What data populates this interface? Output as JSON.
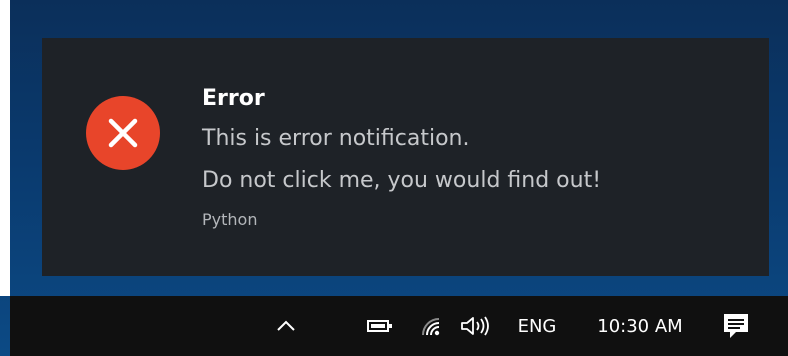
{
  "notification": {
    "title": "Error",
    "lines": [
      "This is error notification.",
      "Do not click me, you would find out!"
    ],
    "source": "Python",
    "icon": "error-x-icon",
    "icon_color": "#e8452a"
  },
  "taskbar": {
    "tray_icons": [
      "chevron-up-icon",
      "battery-icon",
      "wifi-icon",
      "volume-icon"
    ],
    "language": "ENG",
    "time": "10:30 AM",
    "action_center_icon": "notification-center-icon"
  },
  "colors": {
    "toast_background": "#1e2227",
    "taskbar_background": "#101010",
    "desktop": "#0a3a6e"
  }
}
